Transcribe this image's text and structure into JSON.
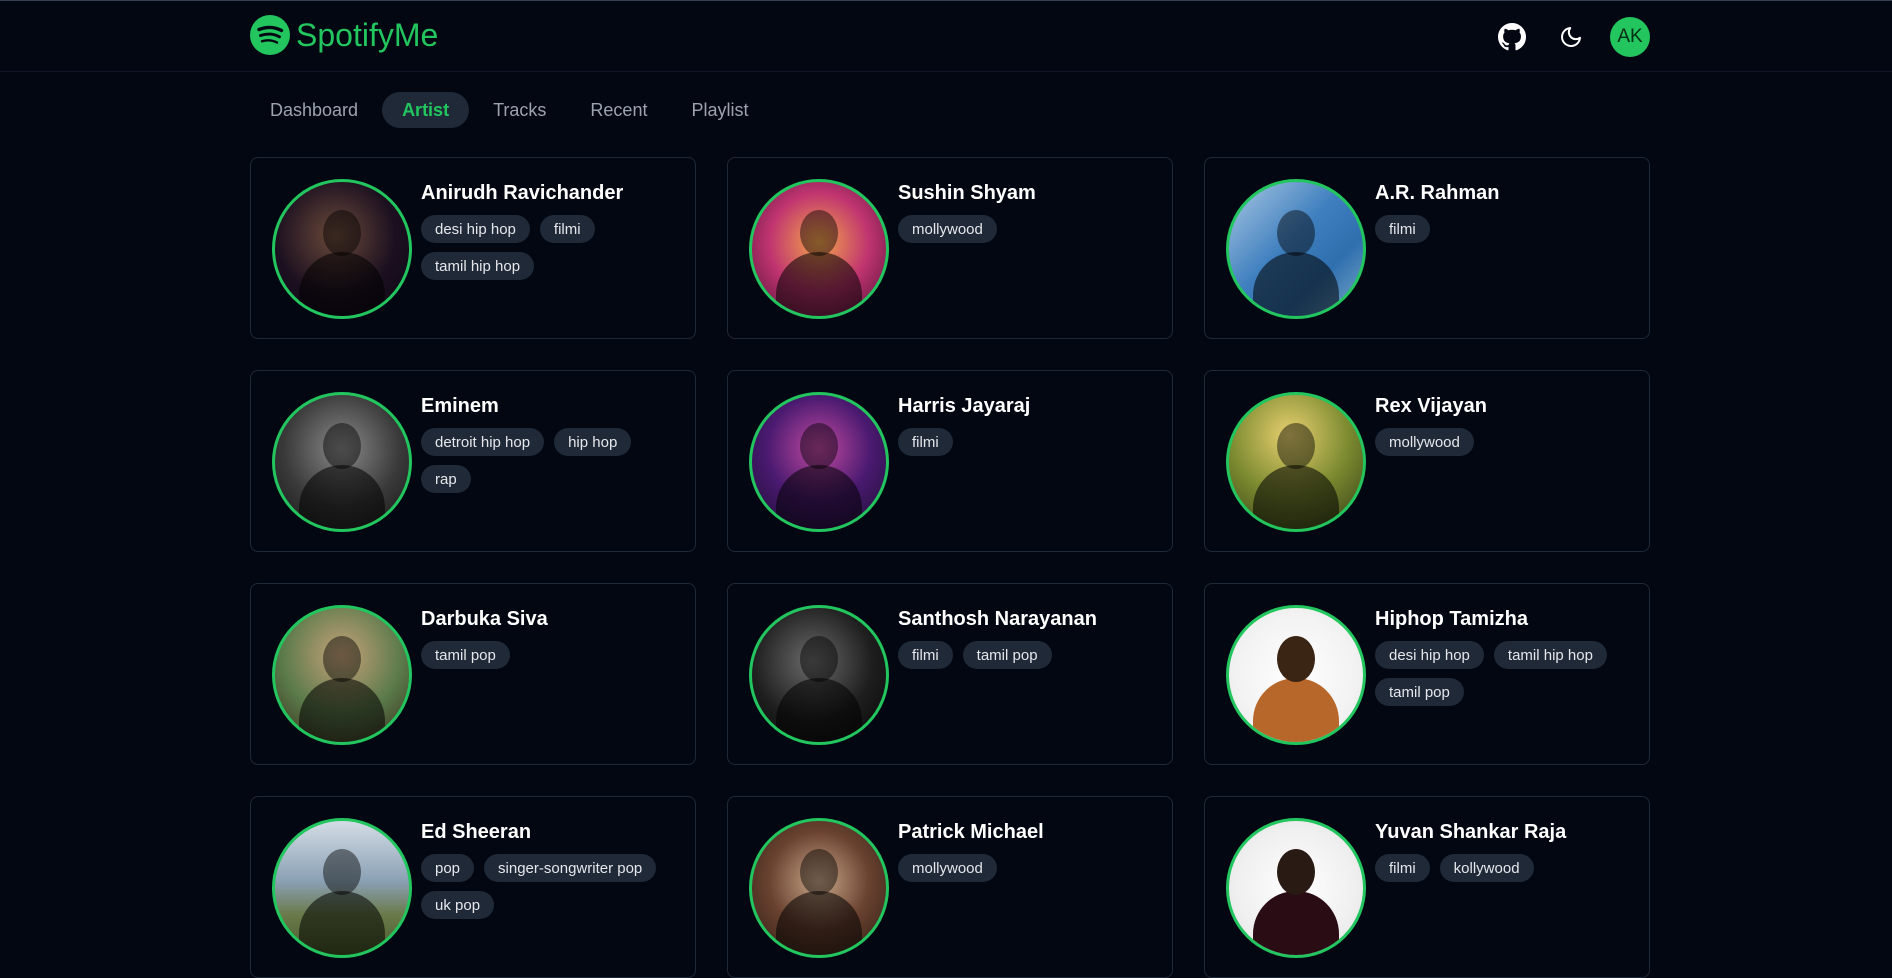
{
  "app": {
    "name": "SpotifyMe",
    "avatar_initials": "AK",
    "accent_color": "#22c55e",
    "background_color": "#030712"
  },
  "nav": {
    "tabs": [
      {
        "label": "Dashboard",
        "active": false
      },
      {
        "label": "Artist",
        "active": true
      },
      {
        "label": "Tracks",
        "active": false
      },
      {
        "label": "Recent",
        "active": false
      },
      {
        "label": "Playlist",
        "active": false
      }
    ]
  },
  "header_icons": [
    "github-icon",
    "moon-icon"
  ],
  "artists": [
    {
      "name": "Anirudh Ravichander",
      "genres": [
        "desi hip hop",
        "filmi",
        "tamil hip hop"
      ]
    },
    {
      "name": "Sushin Shyam",
      "genres": [
        "mollywood"
      ]
    },
    {
      "name": "A.R. Rahman",
      "genres": [
        "filmi"
      ]
    },
    {
      "name": "Eminem",
      "genres": [
        "detroit hip hop",
        "hip hop",
        "rap"
      ]
    },
    {
      "name": "Harris Jayaraj",
      "genres": [
        "filmi"
      ]
    },
    {
      "name": "Rex Vijayan",
      "genres": [
        "mollywood"
      ]
    },
    {
      "name": "Darbuka Siva",
      "genres": [
        "tamil pop"
      ]
    },
    {
      "name": "Santhosh Narayanan",
      "genres": [
        "filmi",
        "tamil pop"
      ]
    },
    {
      "name": "Hiphop Tamizha",
      "genres": [
        "desi hip hop",
        "tamil hip hop",
        "tamil pop"
      ]
    },
    {
      "name": "Ed Sheeran",
      "genres": [
        "pop",
        "singer-songwriter pop",
        "uk pop"
      ]
    },
    {
      "name": "Patrick Michael",
      "genres": [
        "mollywood"
      ]
    },
    {
      "name": "Yuvan Shankar Raja",
      "genres": [
        "filmi",
        "kollywood"
      ]
    }
  ]
}
